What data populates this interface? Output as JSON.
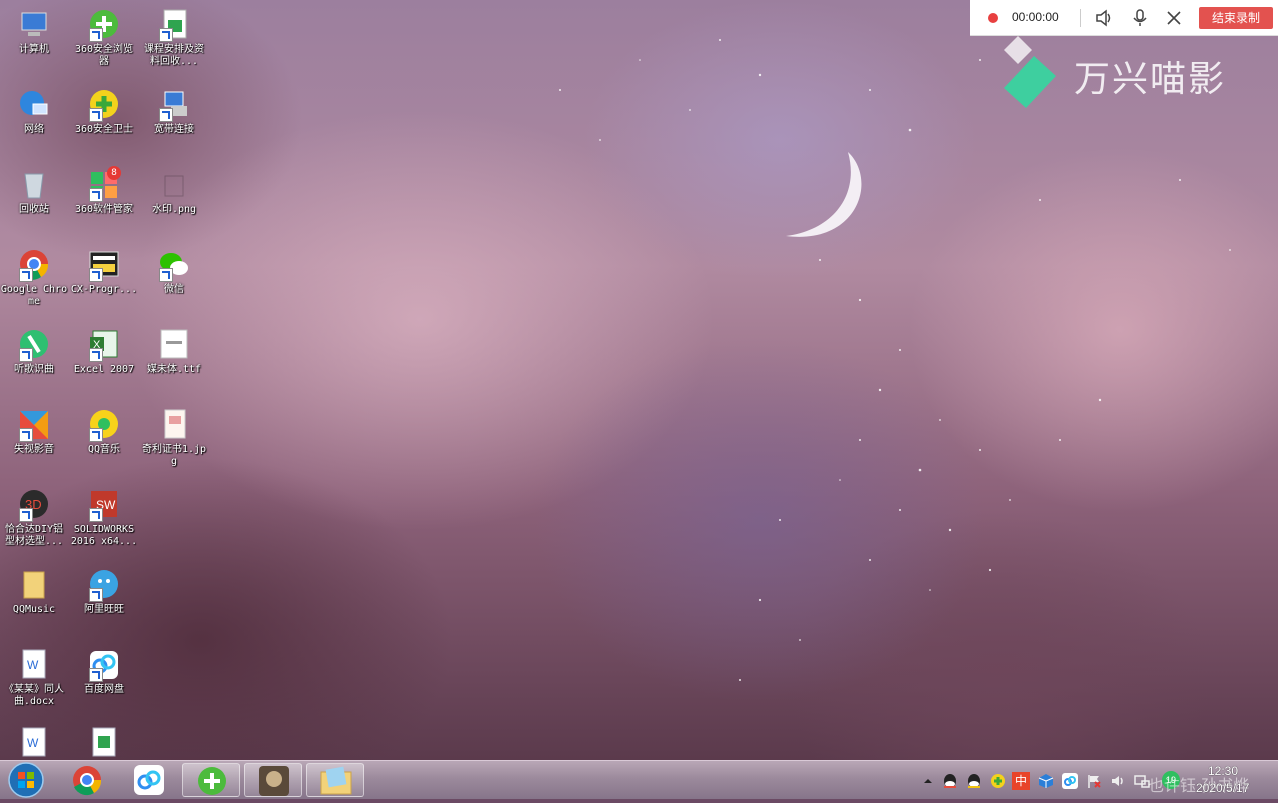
{
  "desktop": {
    "icons": [
      {
        "label": "计算机"
      },
      {
        "label": "360安全浏览器"
      },
      {
        "label": "课程安排及资料回收..."
      },
      {
        "label": "网络"
      },
      {
        "label": "360安全卫士"
      },
      {
        "label": "宽带连接"
      },
      {
        "label": "回收站"
      },
      {
        "label": "360软件管家"
      },
      {
        "label": "水印.png"
      },
      {
        "label": "Google Chrome"
      },
      {
        "label": "CX-Progr..."
      },
      {
        "label": "微信"
      },
      {
        "label": "听歌识曲"
      },
      {
        "label": "Excel 2007"
      },
      {
        "label": "媒未体.ttf"
      },
      {
        "label": "失视影音"
      },
      {
        "label": "QQ音乐"
      },
      {
        "label": "奇利证书1.jpg"
      },
      {
        "label": "恰合达DIY铝型材选型..."
      },
      {
        "label": "SOLIDWORKS 2016 x64..."
      },
      {
        "label": "QQMusic"
      },
      {
        "label": "阿里旺旺"
      },
      {
        "label": "《某某》同人曲.docx"
      },
      {
        "label": "百度网盘"
      }
    ],
    "badge_360_software": "8"
  },
  "recorder": {
    "time": "00:00:00",
    "end_label": "结束录制",
    "brand": "万兴喵影"
  },
  "taskbar": {
    "clock_time": "12:30",
    "clock_date": "2020/5/17",
    "ime_label": "中",
    "badge_count": "19",
    "watermark": "也许钰 孙书烨"
  },
  "colors": {
    "record_red": "#e84040",
    "end_button": "#e3524f",
    "brand_green": "#3ecf9f"
  }
}
